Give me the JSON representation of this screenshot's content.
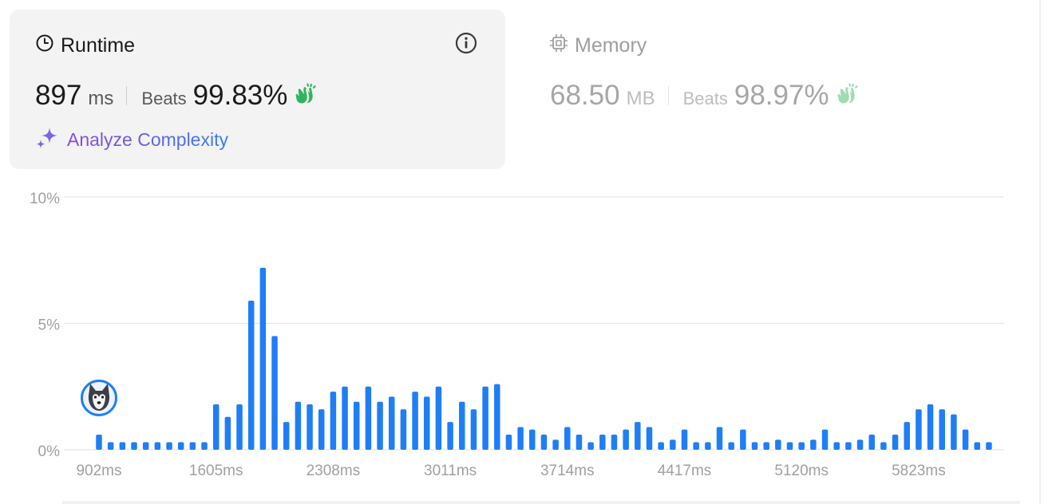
{
  "runtime": {
    "title": "Runtime",
    "value": "897",
    "unit": "ms",
    "beats_label": "Beats",
    "beats_value": "99.83%",
    "analyze_label": "Analyze Complexity",
    "icons": {
      "title": "clock-icon",
      "info": "info-icon",
      "clap": "clap-icon",
      "analyze": "sparkle-icon"
    },
    "colors": {
      "clap": "#2db55d",
      "analyze_start": "#8a4ad8",
      "analyze_end": "#3b7cf0"
    }
  },
  "memory": {
    "title": "Memory",
    "value": "68.50",
    "unit": "MB",
    "beats_label": "Beats",
    "beats_value": "98.97%",
    "icons": {
      "title": "chip-icon",
      "clap": "clap-icon"
    },
    "colors": {
      "clap": "#9fdcb3"
    }
  },
  "chart_data": {
    "type": "bar",
    "title": "",
    "xlabel": "",
    "ylabel": "",
    "ylim": [
      0,
      10
    ],
    "y_ticks": [
      "0%",
      "5%",
      "10%"
    ],
    "x_tick_labels": [
      "902ms",
      "1605ms",
      "2308ms",
      "3011ms",
      "3714ms",
      "4417ms",
      "5120ms",
      "5823ms"
    ],
    "x_tick_bar_index": [
      0,
      10,
      20,
      30,
      40,
      50,
      60,
      70
    ],
    "values": [
      0.6,
      0.3,
      0.3,
      0.3,
      0.3,
      0.3,
      0.3,
      0.3,
      0.3,
      0.3,
      1.8,
      1.3,
      1.8,
      5.9,
      7.2,
      4.5,
      1.1,
      1.9,
      1.8,
      1.6,
      2.3,
      2.5,
      1.9,
      2.5,
      1.9,
      2.1,
      1.6,
      2.3,
      2.1,
      2.5,
      1.1,
      1.9,
      1.6,
      2.5,
      2.6,
      0.6,
      0.9,
      0.8,
      0.6,
      0.4,
      0.9,
      0.6,
      0.3,
      0.6,
      0.6,
      0.8,
      1.1,
      0.9,
      0.3,
      0.4,
      0.8,
      0.3,
      0.3,
      0.9,
      0.3,
      0.8,
      0.3,
      0.3,
      0.4,
      0.3,
      0.3,
      0.4,
      0.8,
      0.3,
      0.3,
      0.4,
      0.6,
      0.3,
      0.6,
      1.1,
      1.6,
      1.8,
      1.6,
      1.4,
      0.8,
      0.3,
      0.3
    ],
    "highlight_index": 0,
    "marker_icon": "user-avatar-icon",
    "grid": true,
    "colors": {
      "bar": "#1f7ef5",
      "grid": "#e6e6e6",
      "tick": "#a0a0a0",
      "avatar_ring": "#1f7ef5"
    }
  }
}
